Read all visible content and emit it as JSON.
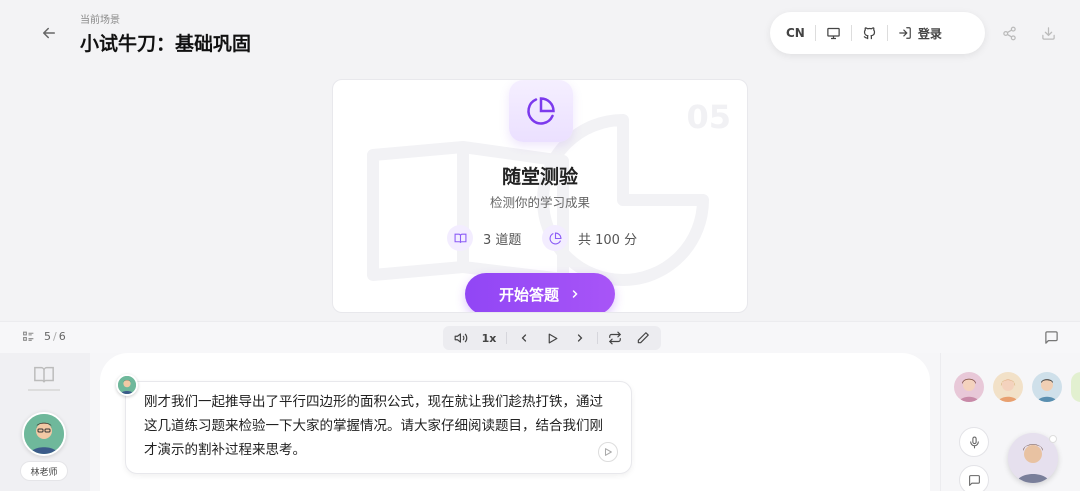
{
  "header": {
    "scene_label": "当前场景",
    "title": "小试牛刀：基础巩固",
    "toolbar": {
      "lang": "CN",
      "login": "登录"
    }
  },
  "card": {
    "number": "05",
    "title": "随堂测验",
    "subtitle": "检测你的学习成果",
    "questions": "3 道题",
    "score": "共 100 分",
    "start_button": "开始答题",
    "accent": "#9146f5"
  },
  "controls": {
    "page": "5",
    "total": "6",
    "speed": "1x"
  },
  "teacher": {
    "name": "林老师"
  },
  "message": {
    "text": "刚才我们一起推导出了平行四边形的面积公式，现在就让我们趁热打铁，通过这几道练习题来检验一下大家的掌握情况。请大家仔细阅读题目，结合我们刚才演示的割补过程来思考。"
  },
  "icons": [
    "back-arrow-icon",
    "monitor-icon",
    "github-icon",
    "login-icon",
    "share-icon",
    "download-icon",
    "pie-chart-icon",
    "book-icon",
    "list-icon",
    "volume-icon",
    "prev-icon",
    "play-icon",
    "next-icon",
    "repeat-icon",
    "pen-icon",
    "chat-icon",
    "mic-icon"
  ]
}
